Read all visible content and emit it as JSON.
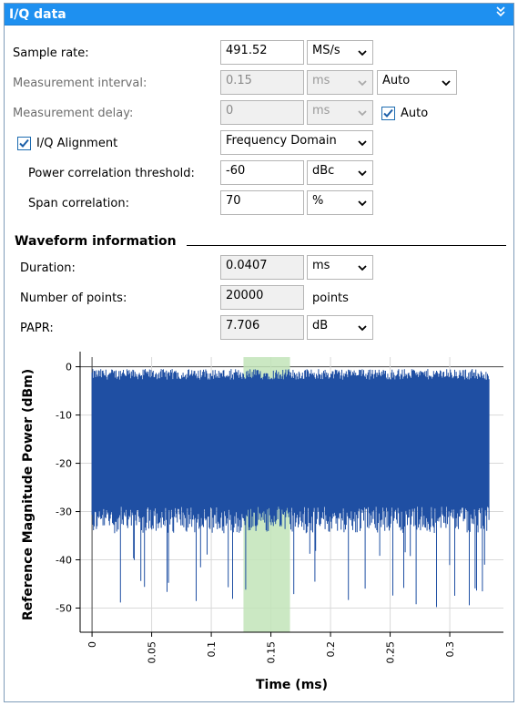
{
  "panel": {
    "title": "I/Q data",
    "collapse_icon": "double-chevron-icon"
  },
  "settings": {
    "sample_rate": {
      "label": "Sample rate:",
      "value": "491.52",
      "unit": "MS/s"
    },
    "measurement_interval": {
      "label": "Measurement interval:",
      "value": "0.15",
      "unit": "ms",
      "mode": "Auto"
    },
    "measurement_delay": {
      "label": "Measurement delay:",
      "value": "0",
      "unit": "ms",
      "auto_label": "Auto",
      "auto_checked": true
    },
    "iq_alignment": {
      "label": "I/Q Alignment",
      "checked": true,
      "value": "Frequency Domain"
    },
    "power_correlation": {
      "label": "Power correlation threshold:",
      "value": "-60",
      "unit": "dBc"
    },
    "span_correlation": {
      "label": "Span correlation:",
      "value": "70",
      "unit": "%"
    }
  },
  "waveform": {
    "title": "Waveform information",
    "duration": {
      "label": "Duration:",
      "value": "0.0407",
      "unit": "ms"
    },
    "points": {
      "label": "Number of points:",
      "value": "20000",
      "unit": "points"
    },
    "papr": {
      "label": "PAPR:",
      "value": "7.706",
      "unit": "dB"
    }
  },
  "chart_data": {
    "type": "area",
    "xlabel": "Time (ms)",
    "ylabel": "Reference Magnitude Power (dBm)",
    "xlim": [
      -0.01,
      0.345
    ],
    "ylim": [
      -55,
      2
    ],
    "x_ticks": [
      "0",
      "0.05",
      "0.1",
      "0.15",
      "0.2",
      "0.25",
      "0.3"
    ],
    "y_ticks": [
      "0",
      "-10",
      "-20",
      "-30",
      "-40",
      "-50"
    ],
    "grid": true,
    "series": [
      {
        "x_range": [
          0,
          0.333
        ],
        "upper_envelope": -2,
        "body_bottom": -29,
        "min_dip": -54,
        "color": "#1f4fa3"
      }
    ],
    "highlight": {
      "x_range": [
        0.127,
        0.166
      ],
      "color": "#c2e4b8"
    }
  }
}
